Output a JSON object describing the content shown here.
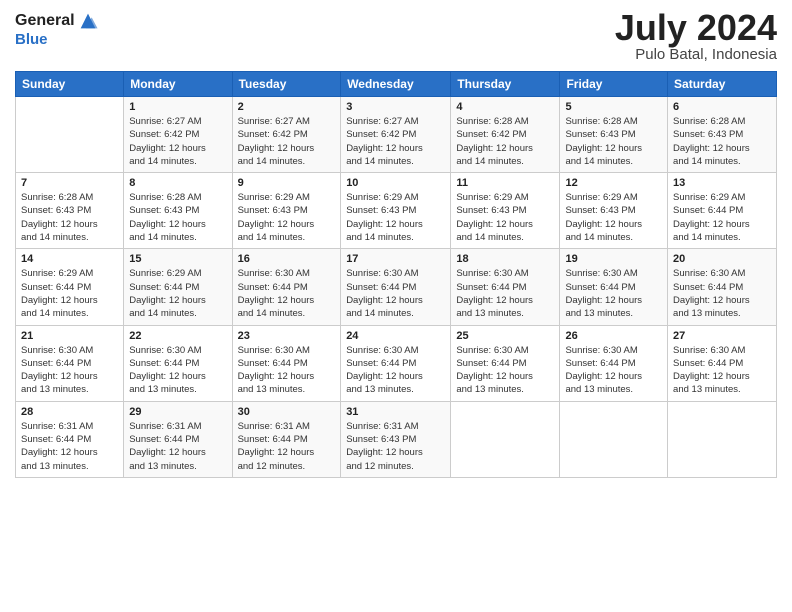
{
  "logo": {
    "line1": "General",
    "line2": "Blue"
  },
  "title": "July 2024",
  "subtitle": "Pulo Batal, Indonesia",
  "days_header": [
    "Sunday",
    "Monday",
    "Tuesday",
    "Wednesday",
    "Thursday",
    "Friday",
    "Saturday"
  ],
  "weeks": [
    [
      {
        "day": "",
        "info": ""
      },
      {
        "day": "1",
        "info": "Sunrise: 6:27 AM\nSunset: 6:42 PM\nDaylight: 12 hours\nand 14 minutes."
      },
      {
        "day": "2",
        "info": "Sunrise: 6:27 AM\nSunset: 6:42 PM\nDaylight: 12 hours\nand 14 minutes."
      },
      {
        "day": "3",
        "info": "Sunrise: 6:27 AM\nSunset: 6:42 PM\nDaylight: 12 hours\nand 14 minutes."
      },
      {
        "day": "4",
        "info": "Sunrise: 6:28 AM\nSunset: 6:42 PM\nDaylight: 12 hours\nand 14 minutes."
      },
      {
        "day": "5",
        "info": "Sunrise: 6:28 AM\nSunset: 6:43 PM\nDaylight: 12 hours\nand 14 minutes."
      },
      {
        "day": "6",
        "info": "Sunrise: 6:28 AM\nSunset: 6:43 PM\nDaylight: 12 hours\nand 14 minutes."
      }
    ],
    [
      {
        "day": "7",
        "info": "Sunrise: 6:28 AM\nSunset: 6:43 PM\nDaylight: 12 hours\nand 14 minutes."
      },
      {
        "day": "8",
        "info": "Sunrise: 6:28 AM\nSunset: 6:43 PM\nDaylight: 12 hours\nand 14 minutes."
      },
      {
        "day": "9",
        "info": "Sunrise: 6:29 AM\nSunset: 6:43 PM\nDaylight: 12 hours\nand 14 minutes."
      },
      {
        "day": "10",
        "info": "Sunrise: 6:29 AM\nSunset: 6:43 PM\nDaylight: 12 hours\nand 14 minutes."
      },
      {
        "day": "11",
        "info": "Sunrise: 6:29 AM\nSunset: 6:43 PM\nDaylight: 12 hours\nand 14 minutes."
      },
      {
        "day": "12",
        "info": "Sunrise: 6:29 AM\nSunset: 6:43 PM\nDaylight: 12 hours\nand 14 minutes."
      },
      {
        "day": "13",
        "info": "Sunrise: 6:29 AM\nSunset: 6:44 PM\nDaylight: 12 hours\nand 14 minutes."
      }
    ],
    [
      {
        "day": "14",
        "info": "Sunrise: 6:29 AM\nSunset: 6:44 PM\nDaylight: 12 hours\nand 14 minutes."
      },
      {
        "day": "15",
        "info": "Sunrise: 6:29 AM\nSunset: 6:44 PM\nDaylight: 12 hours\nand 14 minutes."
      },
      {
        "day": "16",
        "info": "Sunrise: 6:30 AM\nSunset: 6:44 PM\nDaylight: 12 hours\nand 14 minutes."
      },
      {
        "day": "17",
        "info": "Sunrise: 6:30 AM\nSunset: 6:44 PM\nDaylight: 12 hours\nand 14 minutes."
      },
      {
        "day": "18",
        "info": "Sunrise: 6:30 AM\nSunset: 6:44 PM\nDaylight: 12 hours\nand 13 minutes."
      },
      {
        "day": "19",
        "info": "Sunrise: 6:30 AM\nSunset: 6:44 PM\nDaylight: 12 hours\nand 13 minutes."
      },
      {
        "day": "20",
        "info": "Sunrise: 6:30 AM\nSunset: 6:44 PM\nDaylight: 12 hours\nand 13 minutes."
      }
    ],
    [
      {
        "day": "21",
        "info": "Sunrise: 6:30 AM\nSunset: 6:44 PM\nDaylight: 12 hours\nand 13 minutes."
      },
      {
        "day": "22",
        "info": "Sunrise: 6:30 AM\nSunset: 6:44 PM\nDaylight: 12 hours\nand 13 minutes."
      },
      {
        "day": "23",
        "info": "Sunrise: 6:30 AM\nSunset: 6:44 PM\nDaylight: 12 hours\nand 13 minutes."
      },
      {
        "day": "24",
        "info": "Sunrise: 6:30 AM\nSunset: 6:44 PM\nDaylight: 12 hours\nand 13 minutes."
      },
      {
        "day": "25",
        "info": "Sunrise: 6:30 AM\nSunset: 6:44 PM\nDaylight: 12 hours\nand 13 minutes."
      },
      {
        "day": "26",
        "info": "Sunrise: 6:30 AM\nSunset: 6:44 PM\nDaylight: 12 hours\nand 13 minutes."
      },
      {
        "day": "27",
        "info": "Sunrise: 6:30 AM\nSunset: 6:44 PM\nDaylight: 12 hours\nand 13 minutes."
      }
    ],
    [
      {
        "day": "28",
        "info": "Sunrise: 6:31 AM\nSunset: 6:44 PM\nDaylight: 12 hours\nand 13 minutes."
      },
      {
        "day": "29",
        "info": "Sunrise: 6:31 AM\nSunset: 6:44 PM\nDaylight: 12 hours\nand 13 minutes."
      },
      {
        "day": "30",
        "info": "Sunrise: 6:31 AM\nSunset: 6:44 PM\nDaylight: 12 hours\nand 12 minutes."
      },
      {
        "day": "31",
        "info": "Sunrise: 6:31 AM\nSunset: 6:43 PM\nDaylight: 12 hours\nand 12 minutes."
      },
      {
        "day": "",
        "info": ""
      },
      {
        "day": "",
        "info": ""
      },
      {
        "day": "",
        "info": ""
      }
    ]
  ]
}
